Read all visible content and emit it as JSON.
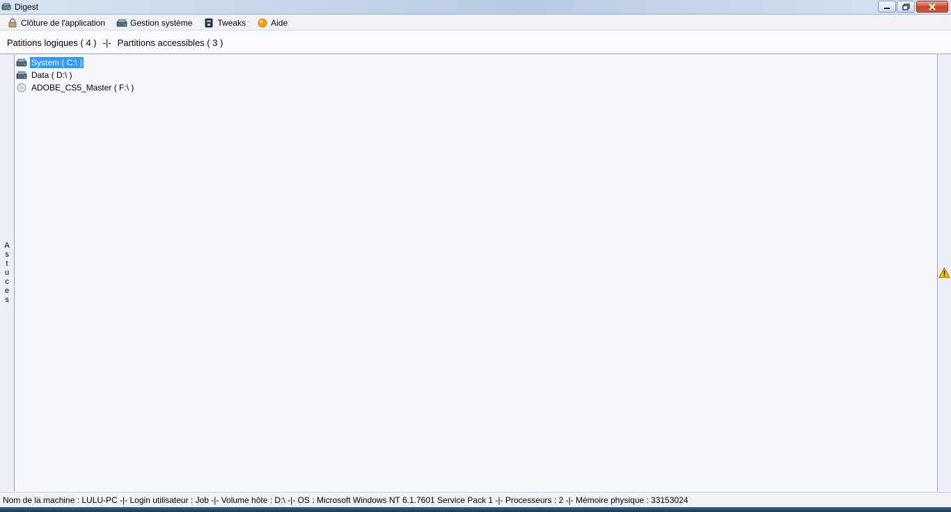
{
  "window": {
    "title": "Digest"
  },
  "menu": {
    "items": [
      {
        "label": "Clôture de l'application",
        "icon": "lock-icon"
      },
      {
        "label": "Gestion système",
        "icon": "drive-icon"
      },
      {
        "label": "Tweaks",
        "icon": "tweaks-icon"
      },
      {
        "label": "Aide",
        "icon": "help-icon"
      }
    ]
  },
  "tabs": {
    "logical": "Patitions logiques ( 4 )",
    "separator": "-|-",
    "accessible": "Partitions accessibles ( 3 )"
  },
  "side_panel": {
    "label": "Astuces"
  },
  "tree": {
    "items": [
      {
        "label": "System ( C:\\ )",
        "icon": "hard-drive-icon",
        "selected": true
      },
      {
        "label": "Data ( D:\\ )",
        "icon": "hard-drive-icon",
        "selected": false
      },
      {
        "label": "ADOBE_CS5_Master ( F:\\ )",
        "icon": "cd-drive-icon",
        "selected": false
      }
    ]
  },
  "status": {
    "text": "Nom de la machine : LULU-PC  -|- Login utilisateur : Job  -|-  Volume hôte : D:\\  -|-  OS : Microsoft Windows NT 6.1.7601 Service Pack 1  -|-  Processeurs : 2 -|- Mémoire physique : 33153024"
  },
  "colors": {
    "selection": "#3399ff",
    "warning": "#f5c400"
  }
}
